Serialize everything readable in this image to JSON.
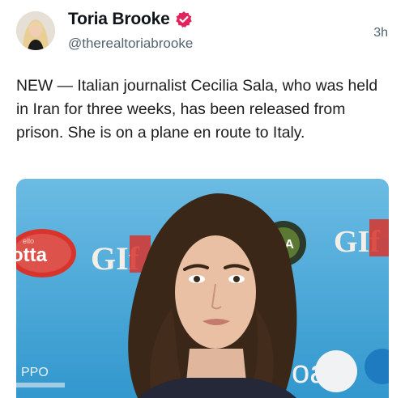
{
  "post": {
    "author": {
      "display_name": "Toria Brooke",
      "handle": "@therealtoriabrooke",
      "verified": true,
      "verified_color": "#e0245e"
    },
    "timestamp": "3h",
    "text": "NEW — Italian journalist Cecilia Sala, who was held in Iran for three weeks, has been released from prison. She is on a plane en route to Italy.",
    "media": {
      "type": "photo",
      "backdrop_texts": {
        "brand_left": "otta",
        "brand_left_small": "ello",
        "gif_1": "GIf",
        "gif_2": "GIf",
        "ma": "MA",
        "bottom_left": "PPO",
        "bottom_right": "oa"
      }
    }
  },
  "colors": {
    "text_primary": "#0f1419",
    "text_secondary": "#536471",
    "backdrop_blue": "#3aa5da",
    "accent_red": "#d8342b"
  }
}
